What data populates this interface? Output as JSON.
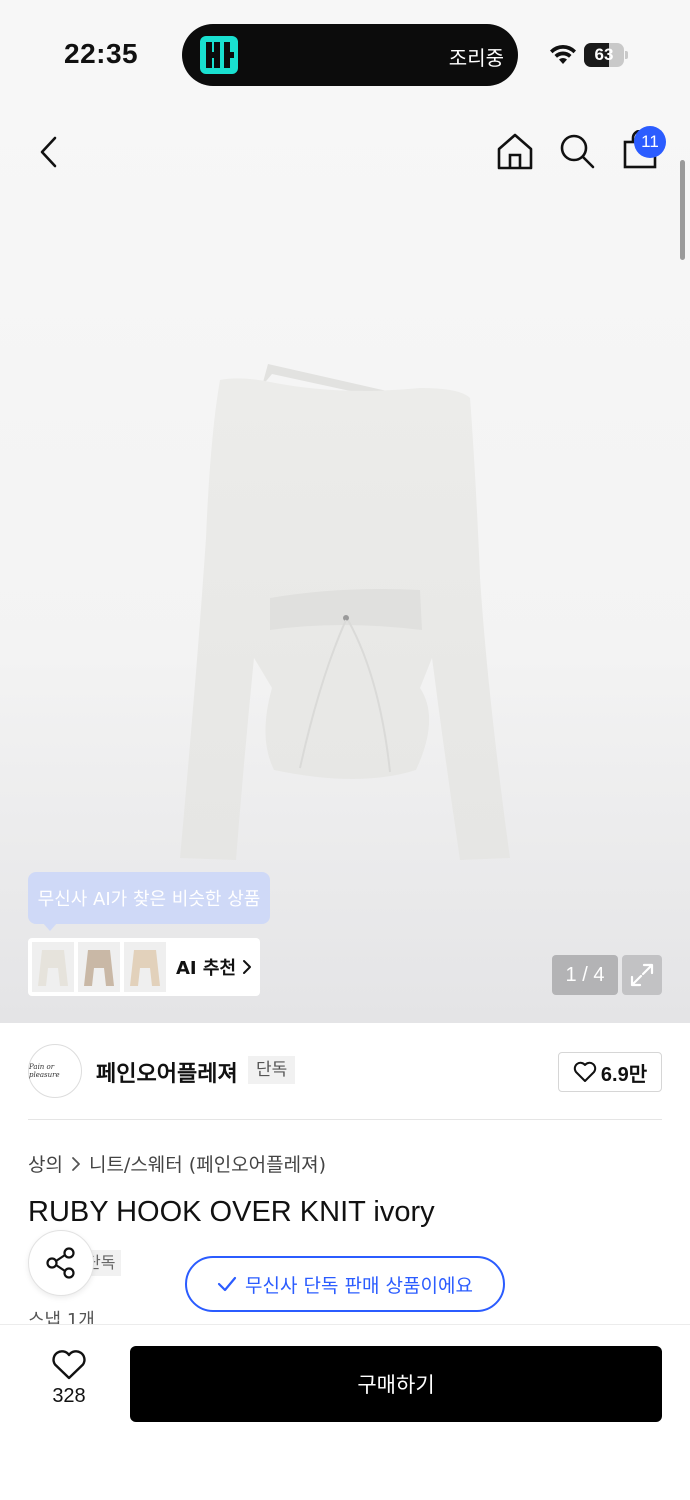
{
  "status_bar": {
    "time": "22:35",
    "activity_text": "조리중",
    "battery_level": "63",
    "battery_fraction": 0.63
  },
  "header": {
    "cart_badge": "11"
  },
  "gallery": {
    "page_indicator": "1 / 4",
    "ai_tooltip": "무신사 AI가 찾은 비슷한 상품",
    "ai_label": "AI 추천"
  },
  "brand": {
    "logo_text": "Pain or pleasure",
    "name": "페인오어플레져",
    "tag": "단독",
    "likes": "6.9만"
  },
  "product": {
    "breadcrumb": [
      "상의",
      "니트/스웨터 (페인오어플레져)"
    ],
    "title": "RUBY HOOK OVER KNIT ivory",
    "exclusive_chip": "단독",
    "exclusive_notice": "무신사 단독 판매 상품이에요",
    "snap_text": "스냅 1개"
  },
  "bottom_bar": {
    "wish_count": "328",
    "buy_label": "구매하기"
  },
  "colors": {
    "accent_blue": "#2b5cff",
    "buy_button": "#000000",
    "tooltip_bg": "#cfd9f7"
  }
}
